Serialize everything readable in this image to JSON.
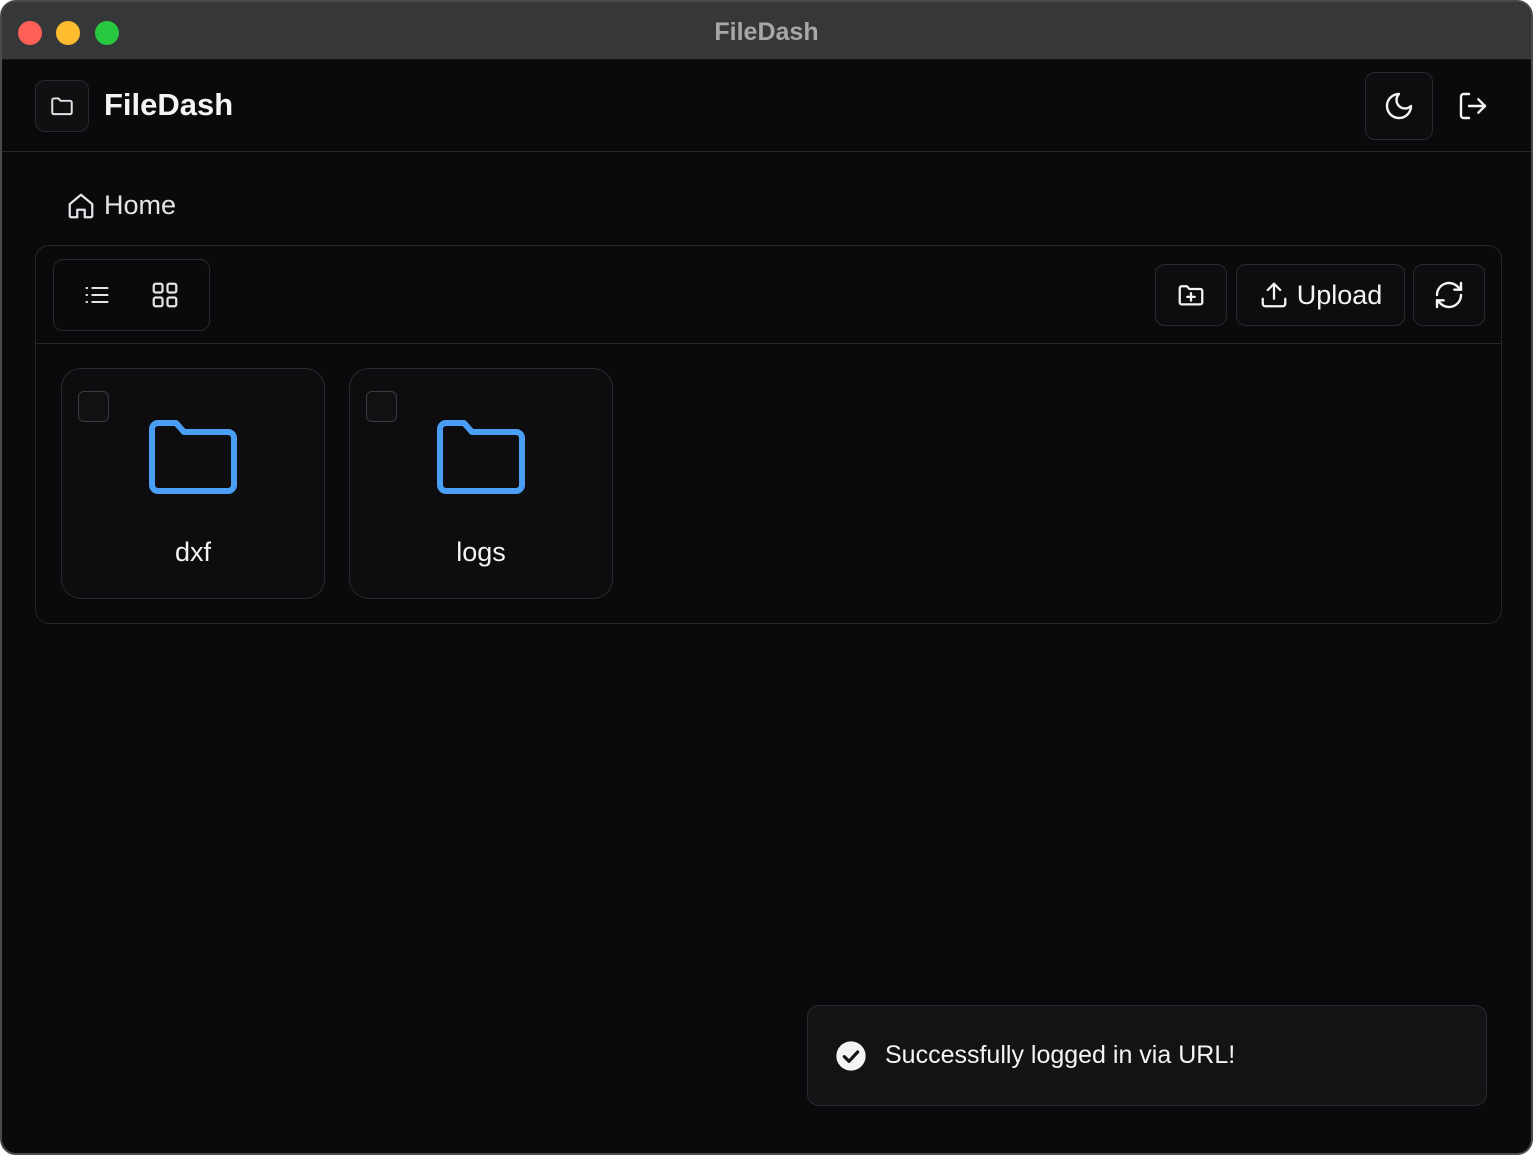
{
  "window": {
    "title": "FileDash"
  },
  "header": {
    "app_name": "FileDash"
  },
  "breadcrumb": {
    "home_label": "Home"
  },
  "toolbar": {
    "upload_label": "Upload"
  },
  "items": [
    {
      "name": "dxf",
      "type": "folder",
      "icon": "folder-icon"
    },
    {
      "name": "logs",
      "type": "folder",
      "icon": "folder-icon"
    }
  ],
  "toast": {
    "message": "Successfully logged in via URL!",
    "icon": "check-circle-icon"
  },
  "colors": {
    "background": "#0a0a0c",
    "titlebar": "#363738",
    "folder_accent": "#4a9ff5",
    "border": "#27272a",
    "text": "#f4f4f5"
  }
}
